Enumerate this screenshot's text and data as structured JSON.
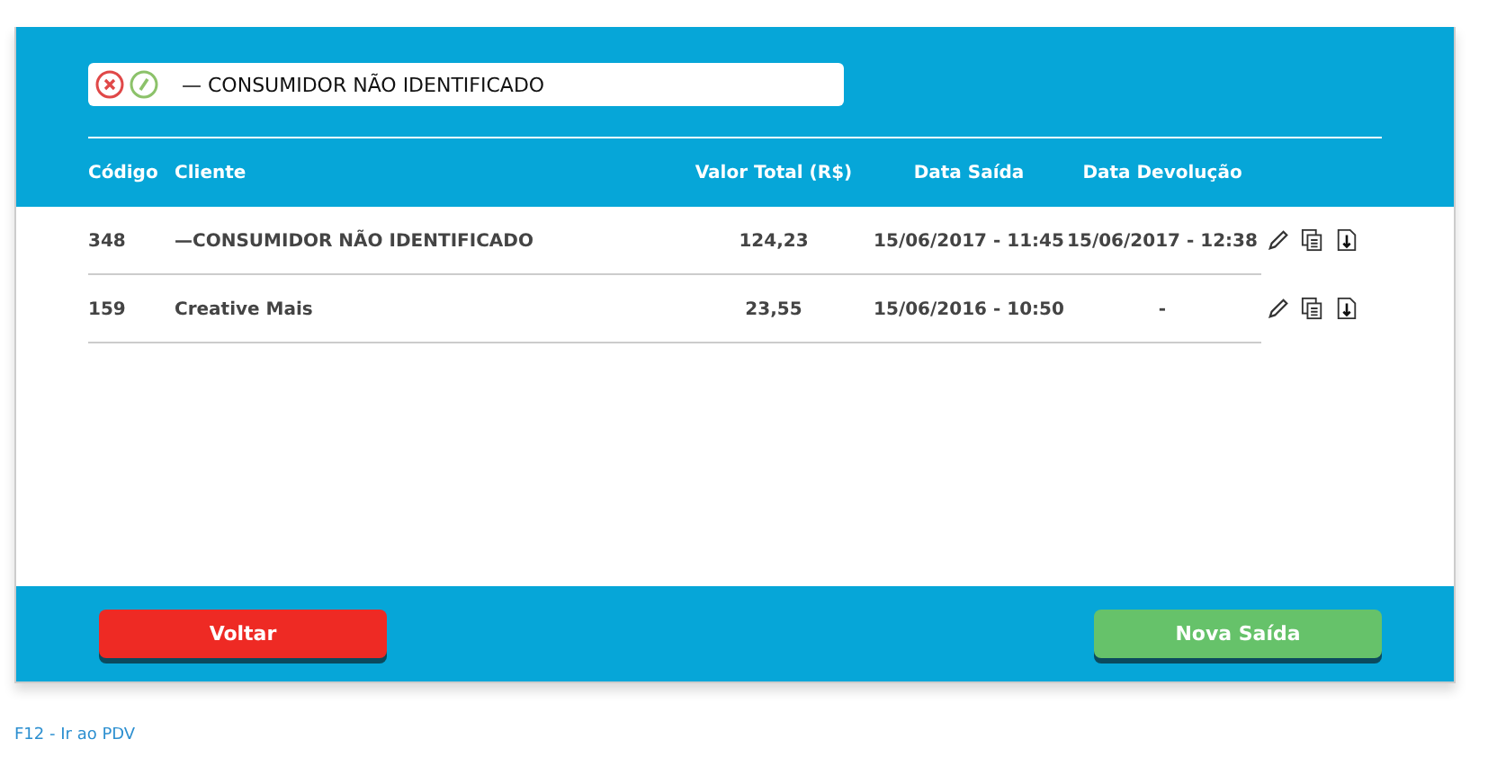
{
  "customer_field": {
    "value": "— CONSUMIDOR NÃO IDENTIFICADO"
  },
  "table": {
    "columns": [
      "Código",
      "Cliente",
      "Valor Total (R$)",
      "Data Saída",
      "Data Devolução"
    ],
    "rows": [
      {
        "codigo": "348",
        "cliente": "—CONSUMIDOR NÃO IDENTIFICADO",
        "valor": "124,23",
        "saida": "15/06/2017 - 11:45",
        "devolucao": "15/06/2017 - 12:38"
      },
      {
        "codigo": "159",
        "cliente": "Creative Mais",
        "valor": "23,55",
        "saida": "15/06/2016 - 10:50",
        "devolucao": "-"
      }
    ]
  },
  "buttons": [
    {
      "label": "Voltar",
      "kind": "danger"
    },
    {
      "label": "Nova Saída",
      "kind": "success"
    }
  ],
  "shortcut": "F12 - Ir ao PDV"
}
